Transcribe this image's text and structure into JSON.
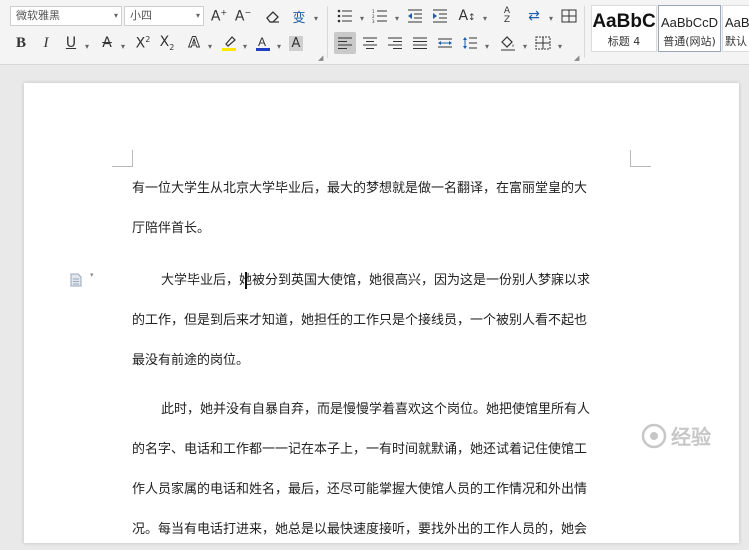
{
  "ribbon": {
    "font_family": "微软雅黑",
    "font_size": "小四",
    "styles": [
      {
        "sample": "AaBbC",
        "label": "标题 4"
      },
      {
        "sample": "AaBbCcD",
        "label": "普通(网站)"
      },
      {
        "sample": "AaB",
        "label": "默认"
      }
    ]
  },
  "document": {
    "paragraphs": [
      {
        "lines": [
          "有一位大学生从北京大学毕业后，最大的梦想就是做一名翻译，在富丽堂皇的大",
          "厅陪伴首长。"
        ]
      },
      {
        "lines": [
          "大学毕业后，她被分到英国大使馆，她很高兴，因为这是一份别人梦寐以求",
          "的工作，但是到后来才知道，她担任的工作只是个接线员，一个被别人看不起也",
          "最没有前途的岗位。"
        ]
      },
      {
        "lines": [
          "此时，她并没有自暴自弃，而是慢慢学着喜欢这个岗位。她把使馆里所有人",
          "的名字、电话和工作都一一记在本子上，一有时间就默诵，她还试着记住使馆工",
          "作人员家属的电话和姓名，最后，还尽可能掌握大使馆人员的工作情况和外出情",
          "况。每当有电话打进来，她总是以最快速度接听，要找外出的工作人员的，她会"
        ]
      }
    ]
  },
  "watermark": {
    "text": "经验"
  }
}
